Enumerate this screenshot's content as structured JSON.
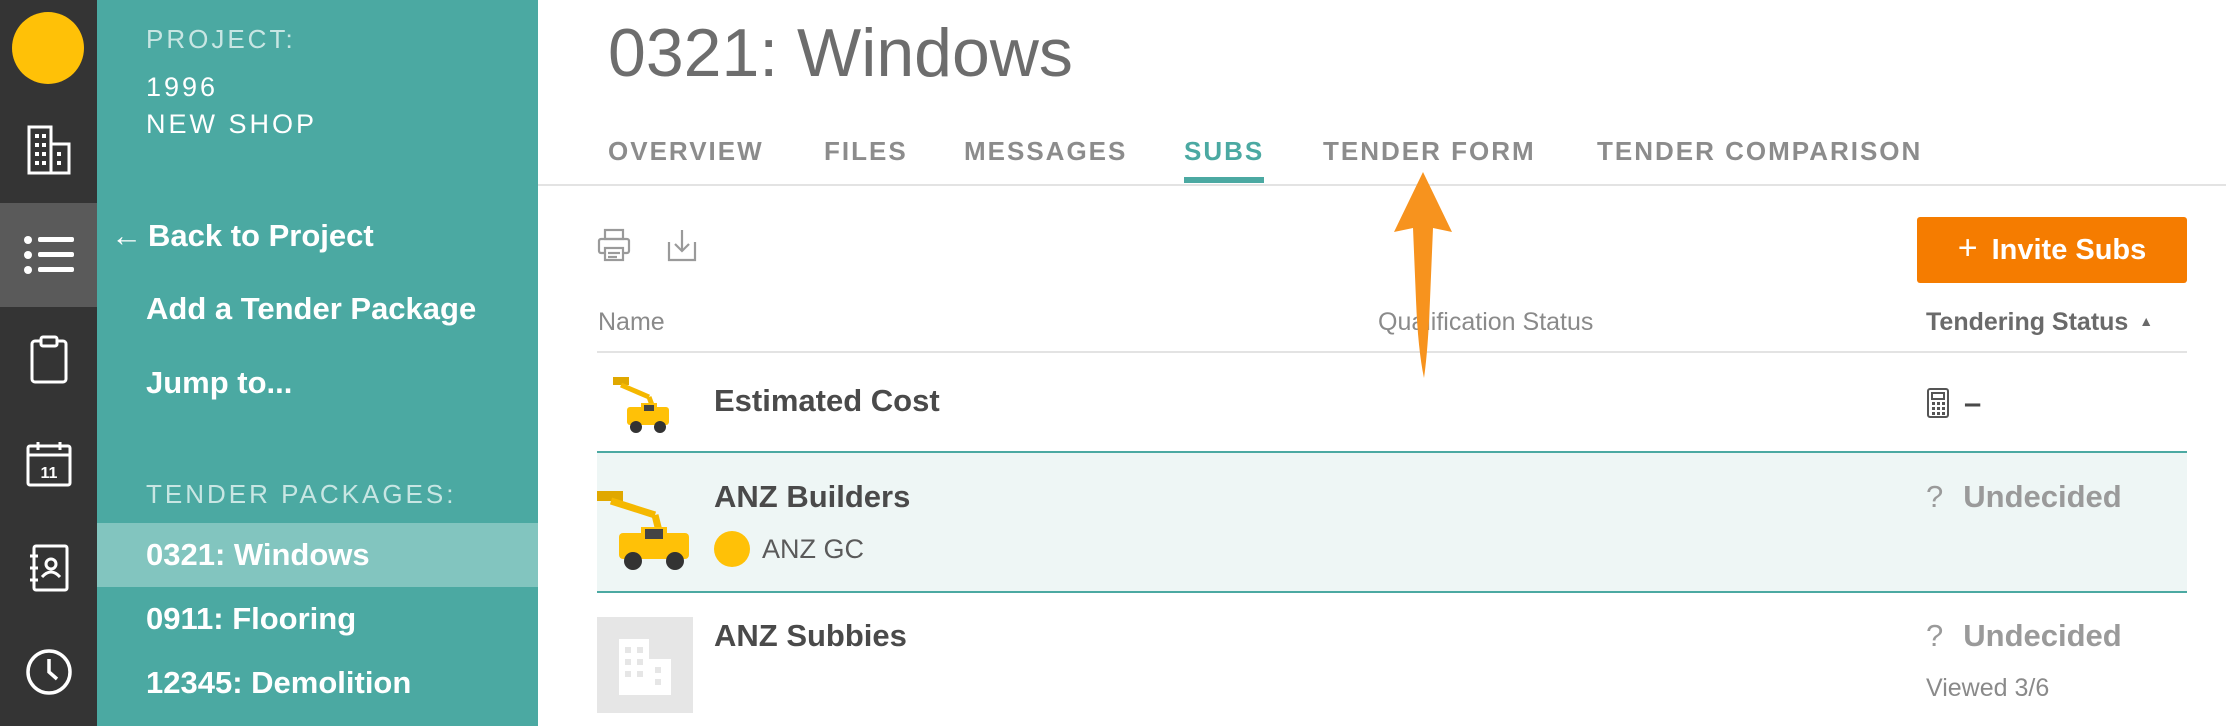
{
  "rail": {
    "icons": [
      "app-logo",
      "building-icon",
      "list-icon",
      "clipboard-icon",
      "calendar-icon",
      "contacts-book-icon",
      "clock-icon"
    ],
    "calendar_day": "11",
    "active_index": 2,
    "logo_color": "#FFC107"
  },
  "sidebar": {
    "project_label": "PROJECT:",
    "project_line1": "1996",
    "project_line2": "NEW SHOP",
    "back_arrow": "←",
    "back_link": "Back to Project",
    "add_package": "Add a Tender Package",
    "jump_to": "Jump to...",
    "packages_label": "TENDER PACKAGES:",
    "packages": [
      {
        "label": "0321: Windows",
        "active": true
      },
      {
        "label": "0911: Flooring",
        "active": false
      },
      {
        "label": "12345: Demolition",
        "active": false
      }
    ]
  },
  "header": {
    "title": "0321: Windows",
    "tabs": [
      "OVERVIEW",
      "FILES",
      "MESSAGES",
      "SUBS",
      "TENDER FORM",
      "TENDER COMPARISON"
    ],
    "active_tab": "SUBS"
  },
  "toolbar": {
    "print_icon": "printer-icon",
    "download_icon": "download-icon",
    "invite_plus": "+",
    "invite_label": "Invite Subs"
  },
  "table": {
    "columns": [
      "Name",
      "Qualification Status",
      "Tendering Status"
    ],
    "sort_indicator": "▲",
    "rows": [
      {
        "name": "Estimated Cost",
        "status_icon": "calculator-icon",
        "status": "–"
      },
      {
        "name": "ANZ Builders",
        "sub": "ANZ GC",
        "status_icon": "question-icon",
        "status_q": "?",
        "status": "Undecided"
      },
      {
        "name": "ANZ Subbies",
        "status_icon": "question-icon",
        "status_q": "?",
        "status": "Undecided",
        "viewed": "Viewed 3/6"
      }
    ]
  },
  "colors": {
    "rail": "#343434",
    "sidebar": "#4BA9A2",
    "accent": "#4BA9A2",
    "invite": "#F57C00",
    "annotation_arrow": "#F7931E"
  }
}
